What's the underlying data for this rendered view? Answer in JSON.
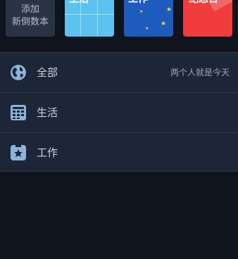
{
  "cards": [
    {
      "id": "add",
      "label_line1": "添加",
      "label_line2": "新倒数本"
    },
    {
      "id": "life",
      "title": "生活"
    },
    {
      "id": "work",
      "title": "工作"
    },
    {
      "id": "memo",
      "title": "纪念日"
    }
  ],
  "list": {
    "items": [
      {
        "label": "全部",
        "right_text": "两个人就是今天",
        "icon": "globe-icon"
      },
      {
        "label": "生活",
        "icon": "calendar-grid-icon"
      },
      {
        "label": "工作",
        "icon": "star-box-icon"
      }
    ]
  },
  "colors": {
    "background": "#10141c",
    "list_background": "#1c2636",
    "card_life": "#5cc3f0",
    "card_work": "#1d5bbd",
    "card_memo": "#f03c3c",
    "icon_color": "#8fb2d9"
  }
}
